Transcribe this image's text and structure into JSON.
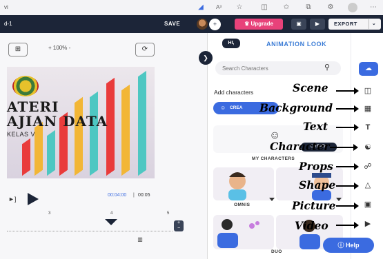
{
  "browser": {
    "url_fragment": "vi",
    "icons": [
      "tag-icon",
      "read-aloud-icon",
      "favorite-icon",
      "split-screen-icon",
      "favorites-bar-icon",
      "collections-icon",
      "extensions-icon",
      "profile-icon",
      "more-icon"
    ],
    "read_aloud_label": "A³"
  },
  "header": {
    "project_name": "d-1",
    "save_label": "SAVE",
    "add_user_glyph": "+",
    "upgrade_label": "Upgrade",
    "export_label": "EXPORT"
  },
  "canvas": {
    "zoom_plus": "+",
    "zoom_level": "100%",
    "zoom_minus": "-",
    "slide_title_line1": "ATERI",
    "slide_title_line2": "AJIAN DATA",
    "slide_subtitle": "KELAS V"
  },
  "timeline": {
    "play_label": "►]",
    "current_time": "00:04:00",
    "separator": "|",
    "total_time": "00:05",
    "ruler_ticks": [
      "3",
      "4",
      "5"
    ]
  },
  "panel": {
    "hi_badge": "HI,",
    "title": "ANIMATION LOOK",
    "search_placeholder": "Search Characters",
    "add_characters": "Add characters",
    "create_label": "CREA",
    "create_chip_label": "CREATE",
    "my_characters_label": "MY CHARACTERS",
    "character_groups": [
      {
        "name": "OMNIS"
      },
      {
        "name": "DUO"
      }
    ],
    "help_label": "Help"
  },
  "annotations": [
    {
      "text": "Scene"
    },
    {
      "text": "Background"
    },
    {
      "text": "Text"
    },
    {
      "text": "Character"
    },
    {
      "text": "Props"
    },
    {
      "text": "Shape"
    },
    {
      "text": "Picture"
    },
    {
      "text": "Video"
    }
  ],
  "rail": {
    "icons": [
      "scene-icon",
      "background-icon",
      "text-icon",
      "character-icon",
      "props-icon",
      "shape-icon",
      "picture-icon",
      "video-icon"
    ]
  },
  "colors": {
    "header_bg": "#1c2538",
    "accent_blue": "#3b6be0",
    "upgrade_pink": "#e8427a",
    "panel_title": "#3a7bd5"
  }
}
